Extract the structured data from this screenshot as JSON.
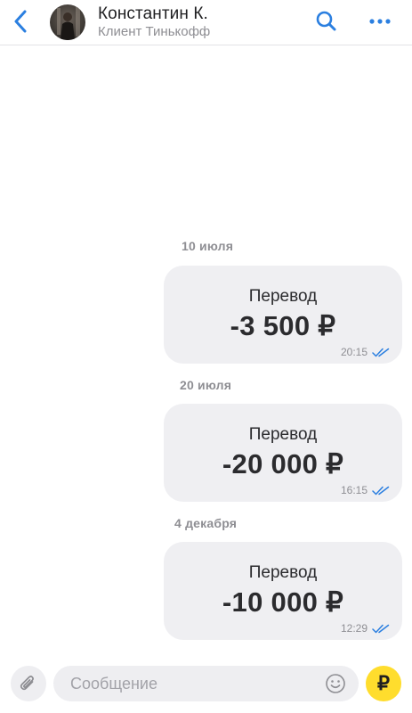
{
  "header": {
    "contact_name": "Константин К.",
    "contact_subtitle": "Клиент Тинькофф"
  },
  "messages": [
    {
      "date": "10 июля",
      "title": "Перевод",
      "amount": "-3 500 ₽",
      "time": "20:15",
      "status": "read"
    },
    {
      "date": "20 июля",
      "title": "Перевод",
      "amount": "-20 000 ₽",
      "time": "16:15",
      "status": "read"
    },
    {
      "date": "4 декабря",
      "title": "Перевод",
      "amount": "-10 000 ₽",
      "time": "12:29",
      "status": "read"
    }
  ],
  "composer": {
    "placeholder": "Сообщение",
    "currency_symbol": "₽"
  },
  "colors": {
    "accent": "#2b7fe0",
    "bubble_bg": "#efeff2",
    "transfer_button": "#ffdd2d"
  },
  "icons": {
    "back": "chevron-left-icon",
    "search": "search-icon",
    "more": "more-dots-icon",
    "attach": "paperclip-icon",
    "emoji": "smiley-icon",
    "read_status": "double-check-icon"
  }
}
